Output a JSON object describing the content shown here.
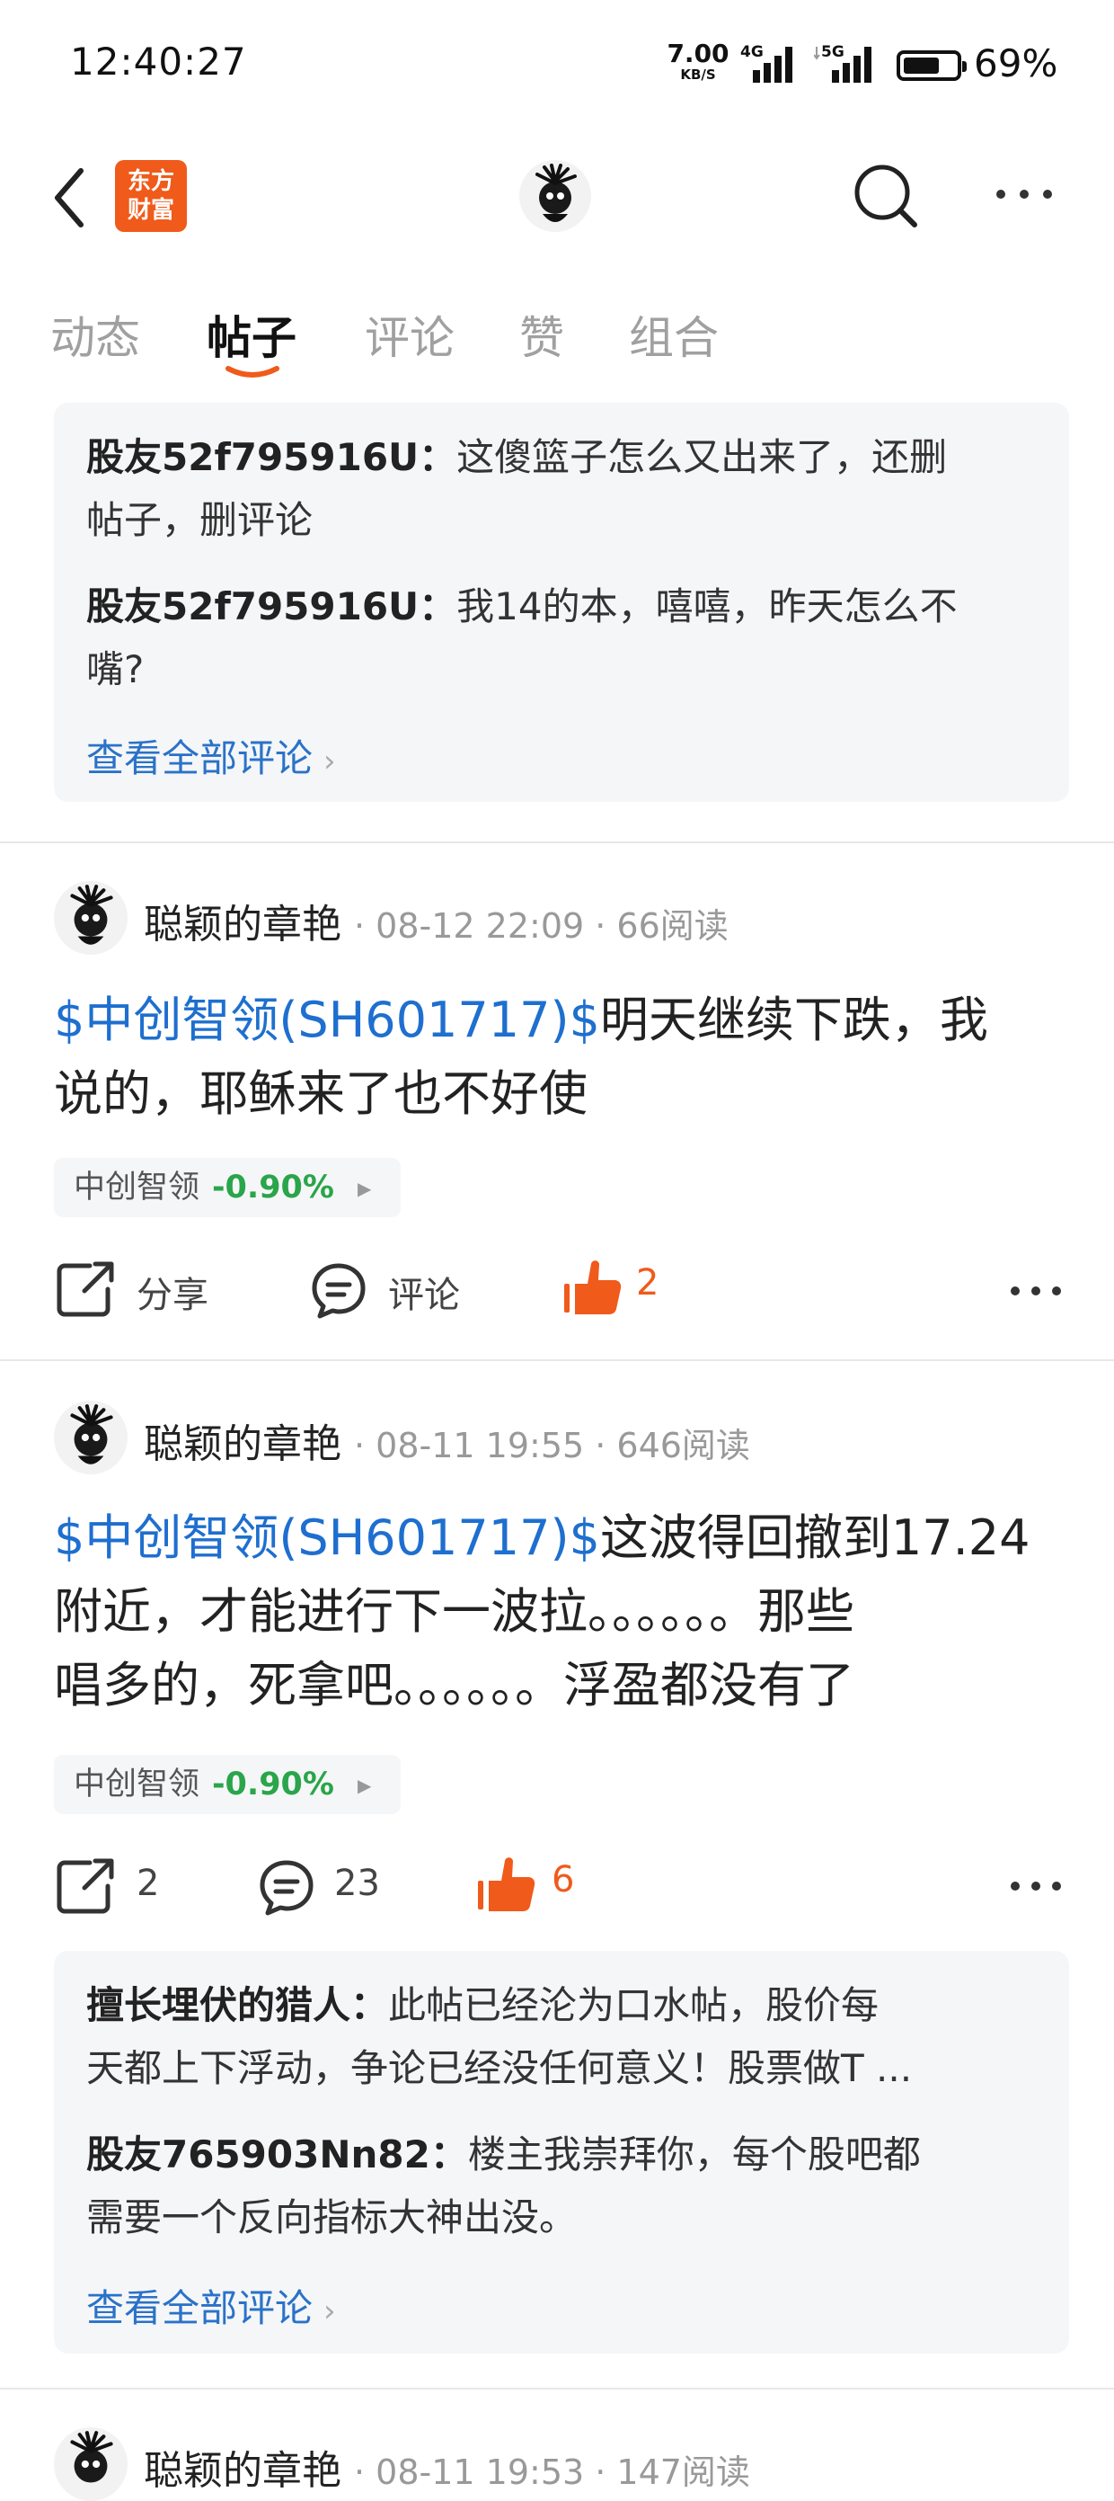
{
  "status_bar": {
    "time": "12:40:27",
    "net_speed": "7.00",
    "net_unit": "KB/S",
    "net_4g": "4G",
    "net_5g": "5G",
    "battery_pct": "69%",
    "battery_level": 0.69
  },
  "header": {
    "logo_line1": "东方",
    "logo_line2": "财富",
    "icons": [
      "back-icon",
      "search-icon",
      "more-icon"
    ]
  },
  "tabs": [
    {
      "label": "动态",
      "active": false
    },
    {
      "label": "帖子",
      "active": true
    },
    {
      "label": "评论",
      "active": false
    },
    {
      "label": "赞",
      "active": false
    },
    {
      "label": "组合",
      "active": false
    }
  ],
  "top_comments": {
    "items": [
      {
        "user": "股友52f795916U：",
        "line1": "这傻篮子怎么又出来了，还删",
        "line2": "帖子，删评论"
      },
      {
        "user": "股友52f795916U：",
        "line1": "我14的本，嘻嘻，昨天怎么不",
        "line2": "嘴?"
      }
    ],
    "view_all": "查看全部评论"
  },
  "posts": [
    {
      "author": "聪颖的章艳",
      "meta": "· 08-12 22:09 · 66阅读",
      "stock_tag": "$中创智领(SH601717)$",
      "text1_rest": "明天继续下跌，我",
      "text2": "说的，耶稣来了也不好使",
      "chip_name": "中创智领",
      "chip_change": "-0.90%",
      "share_label": "分享",
      "comment_label": "评论",
      "like_count": "2"
    },
    {
      "author": "聪颖的章艳",
      "meta": "· 08-11 19:55 · 646阅读",
      "stock_tag": "$中创智领(SH601717)$",
      "text1_rest": "这波得回撤到17.24",
      "text2": "附近，才能进行下一波拉。。。。。。那些",
      "text3": "唱多的，死拿吧。。。。。。浮盈都没有了",
      "chip_name": "中创智领",
      "chip_change": "-0.90%",
      "share_label": "2",
      "comment_label": "23",
      "like_count": "6",
      "comments": {
        "items": [
          {
            "user": "擅长埋伏的猎人：",
            "line1": "此帖已经沦为口水帖，股价每",
            "line2": "天都上下浮动，争论已经没任何意义！股票做T ..."
          },
          {
            "user": "股友765903Nn82：",
            "line1": "楼主我崇拜你，每个股吧都",
            "line2": "需要一个反向指标大神出没。"
          }
        ],
        "view_all": "查看全部评论"
      }
    },
    {
      "author": "聪颖的章艳",
      "meta": "· 08-11 19:53 · 147阅读"
    }
  ],
  "colors": {
    "accent": "#f05a1a",
    "link": "#2a72c8",
    "stock_link": "#1e6fcf",
    "down_green": "#2aa54a"
  }
}
